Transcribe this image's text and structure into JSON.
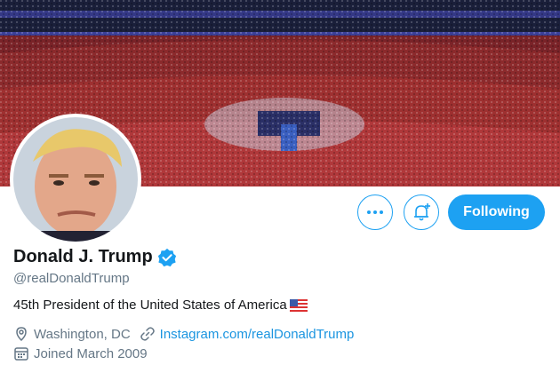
{
  "profile": {
    "name": "Donald J. Trump",
    "handle": "@realDonaldTrump",
    "bio": "45th President of the United States of America",
    "bio_flag": "us-flag-emoji",
    "location": "Washington, DC",
    "website": "Instagram.com/realDonaldTrump",
    "joined": "Joined March 2009",
    "verified": true
  },
  "actions": {
    "more_icon": "more-dots-icon",
    "notify_icon": "bell-plus-icon",
    "follow_label": "Following"
  },
  "colors": {
    "accent": "#1da1f2",
    "text_primary": "#14171a",
    "text_secondary": "#657786",
    "link": "#1b95e0"
  }
}
